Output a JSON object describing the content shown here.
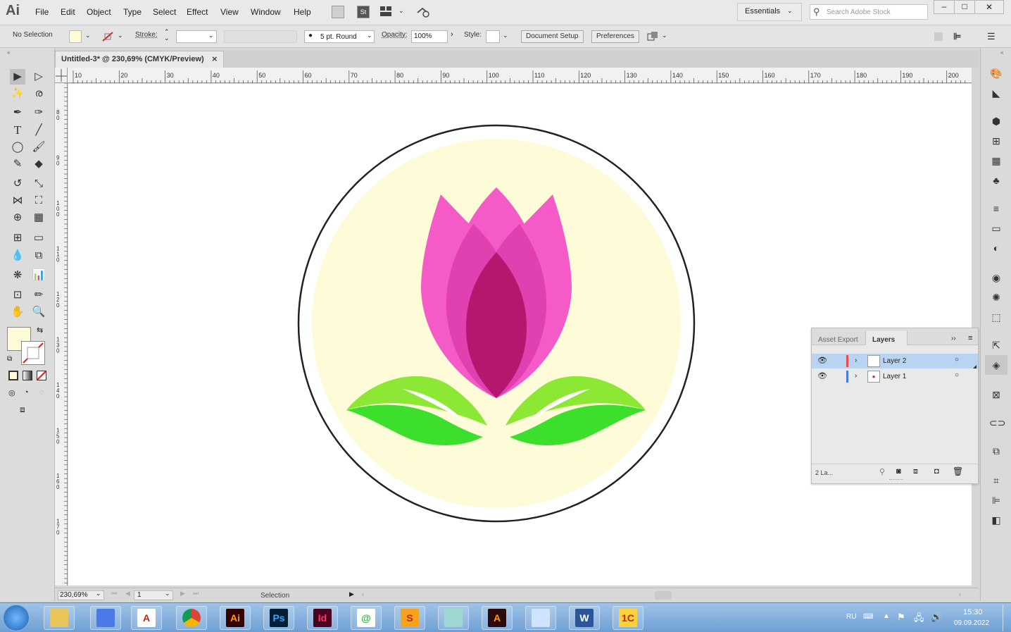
{
  "app": {
    "logo": "Ai"
  },
  "menu": [
    "File",
    "Edit",
    "Object",
    "Type",
    "Select",
    "Effect",
    "View",
    "Window",
    "Help"
  ],
  "menubar_icons": {
    "stock": "St",
    "workspace_switch": "grid-icon"
  },
  "workspace": "Essentials",
  "search": {
    "placeholder": "Search Adobe Stock"
  },
  "window_controls": {
    "minimize": "–",
    "maximize": "□",
    "close": "✕"
  },
  "control_bar": {
    "selection": "No Selection",
    "stroke_label": "Stroke:",
    "brush": "5 pt. Round",
    "opacity_label": "Opacity:",
    "opacity_value": "100%",
    "style_label": "Style:",
    "document_setup": "Document Setup",
    "preferences": "Preferences"
  },
  "document_tab": {
    "title": "Untitled-3* @ 230,69% (CMYK/Preview)",
    "close": "×"
  },
  "ruler": {
    "h_ticks": [
      "10",
      "20",
      "30",
      "40",
      "50",
      "60",
      "70",
      "80",
      "90",
      "100",
      "110",
      "120",
      "130",
      "140",
      "150",
      "160",
      "170",
      "180",
      "190",
      "200"
    ],
    "v_ticks": [
      "8 0",
      "9 0",
      "1 0 0",
      "1 1 0",
      "1 2 0",
      "1 3 0",
      "1 4 0",
      "1 5 0",
      "1 6 0",
      "1 7 0"
    ]
  },
  "artwork": {
    "colors": {
      "outer_ring": "#222222",
      "circle_fill": "#fdfbd8",
      "petal_light": "#f45bc7",
      "petal_mid": "#e040b0",
      "petal_dark": "#b5176f",
      "leaf_light": "#8de835",
      "leaf_dark": "#3ce02c"
    }
  },
  "layers_panel": {
    "tabs": [
      "Asset Export",
      "Layers"
    ],
    "layers": [
      {
        "name": "Layer 2",
        "color": "#e84a4a",
        "selected": true
      },
      {
        "name": "Layer 1",
        "color": "#4a7ae8",
        "selected": false
      }
    ],
    "footer_count": "2 La..."
  },
  "status_bar": {
    "zoom": "230,69%",
    "artboard": "1",
    "tool": "Selection"
  },
  "taskbar": {
    "apps": [
      {
        "name": "start",
        "label": "",
        "color": "#1e60b0"
      },
      {
        "name": "explorer",
        "label": "",
        "color": "#e8c45a"
      },
      {
        "name": "network",
        "label": "",
        "color": "#4a7ae8"
      },
      {
        "name": "acrobat",
        "label": "A",
        "color": "#ffffff"
      },
      {
        "name": "chrome",
        "label": "",
        "color": "#ffffff"
      },
      {
        "name": "illustrator",
        "label": "Ai",
        "color": "#330000"
      },
      {
        "name": "photoshop",
        "label": "Ps",
        "color": "#001e36"
      },
      {
        "name": "indesign",
        "label": "Id",
        "color": "#49021f"
      },
      {
        "name": "at-app",
        "label": "@",
        "color": "#ffffff"
      },
      {
        "name": "skype",
        "label": "S",
        "color": "#f7a21c"
      },
      {
        "name": "notes",
        "label": "",
        "color": "#9ed8d0"
      },
      {
        "name": "acrobat-dark",
        "label": "A",
        "color": "#2a0a0a"
      },
      {
        "name": "paint",
        "label": "",
        "color": "#cfe5ff"
      },
      {
        "name": "word",
        "label": "W",
        "color": "#2b579a"
      },
      {
        "name": "onec",
        "label": "1C",
        "color": "#ffd23c"
      }
    ],
    "lang": "RU",
    "time": "15:30",
    "date": "09.09.2022"
  }
}
